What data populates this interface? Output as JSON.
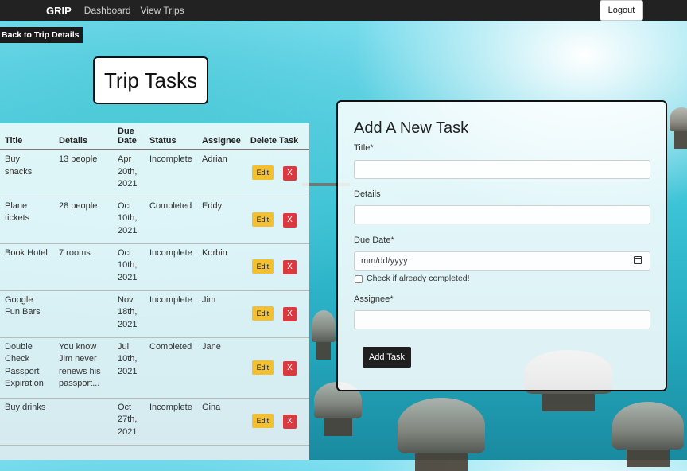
{
  "navbar": {
    "brand": "GRIP",
    "links": [
      "Dashboard",
      "View Trips"
    ],
    "logout_label": "Logout"
  },
  "back_button_label": "Back to Trip Details",
  "page_title": "Trip Tasks",
  "table": {
    "headers": [
      "Title",
      "Details",
      "Due Date",
      "Status",
      "Assignee",
      "Delete Task"
    ],
    "rows": [
      {
        "title": "Buy snacks",
        "details": "13 people",
        "due": "Apr 20th, 2021",
        "status": "Incomplete",
        "assignee": "Adrian"
      },
      {
        "title": "Plane tickets",
        "details": "28 people",
        "due": "Oct 10th, 2021",
        "status": "Completed",
        "assignee": "Eddy"
      },
      {
        "title": "Book Hotel",
        "details": "7 rooms",
        "due": "Oct 10th, 2021",
        "status": "Incomplete",
        "assignee": "Korbin"
      },
      {
        "title": "Google Fun Bars",
        "details": "",
        "due": "Nov 18th, 2021",
        "status": "Incomplete",
        "assignee": "Jim"
      },
      {
        "title": "Double Check Passport Expiration",
        "details": "You know Jim never renews his passport...",
        "due": "Jul 10th, 2021",
        "status": "Completed",
        "assignee": "Jane"
      },
      {
        "title": "Buy drinks",
        "details": "",
        "due": "Oct 27th, 2021",
        "status": "Incomplete",
        "assignee": "Gina"
      }
    ],
    "edit_label": "Edit",
    "delete_label": "X"
  },
  "form": {
    "title": "Add A New Task",
    "title_label": "Title*",
    "details_label": "Details",
    "due_label": "Due Date*",
    "due_placeholder": "mm/dd/yyyy",
    "completed_label": "Check if already completed!",
    "assignee_label": "Assignee*",
    "submit_label": "Add Task"
  },
  "colors": {
    "edit": "#f2c030",
    "delete": "#d9393f",
    "navbar": "#222222"
  }
}
